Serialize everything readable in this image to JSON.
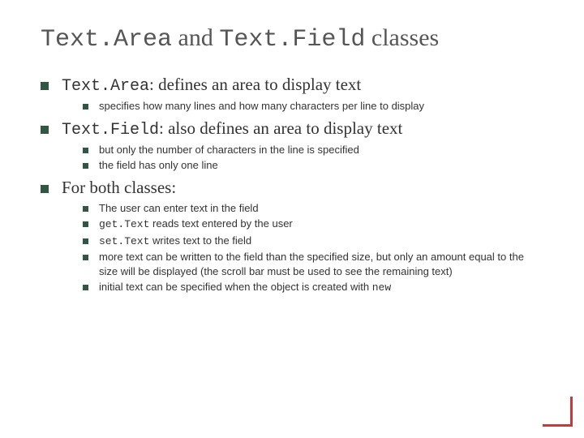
{
  "title": {
    "part1": "Text.Area",
    "part2": " and ",
    "part3": "Text.Field",
    "part4": " classes"
  },
  "points": [
    {
      "headMono": "Text.Area",
      "headRest": ": defines an area to display text",
      "sub": [
        {
          "text": "specifies how many lines and how many characters per line to display"
        }
      ]
    },
    {
      "headMono": "Text.Field",
      "headRest": ": also defines an area to display text",
      "sub": [
        {
          "text": "but only the number of characters in the line is specified"
        },
        {
          "text": "the field has only one line"
        }
      ]
    },
    {
      "headPlain": "For both classes:",
      "sub": [
        {
          "text": "The user can enter text in the field"
        },
        {
          "mono1": "get.Text",
          "rest1": " reads text entered by the user"
        },
        {
          "mono1": "set.Text",
          "rest1": " writes text to the field"
        },
        {
          "text": "more text can be written to the field than the specified size, but only an amount equal to the size will be displayed (the scroll bar must be used to see the remaining text)"
        },
        {
          "pre1": "initial text can be specified when the object is created with ",
          "mono1": "new"
        }
      ]
    }
  ]
}
